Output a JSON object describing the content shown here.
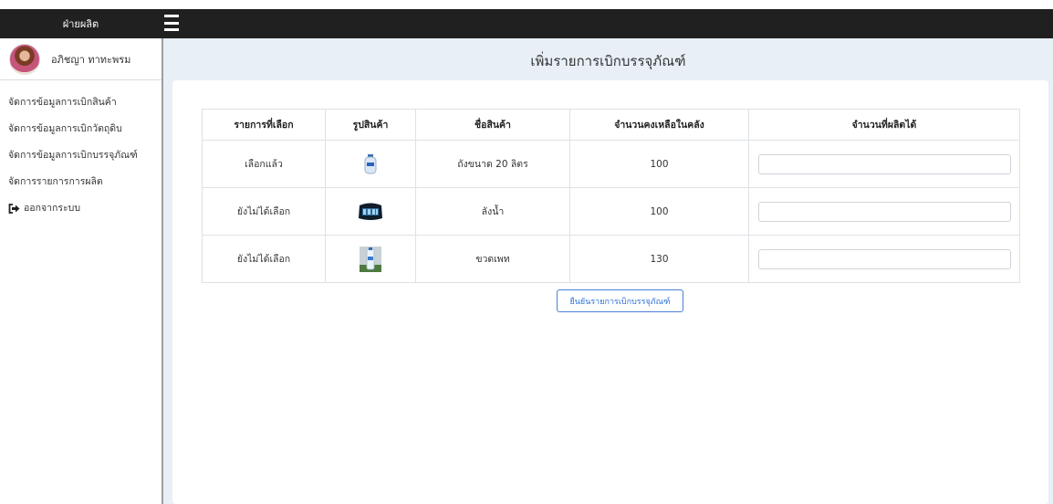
{
  "header": {
    "brand": "ฝ่ายผลิต",
    "menu_icon": "hamburger-icon"
  },
  "sidebar": {
    "user_name": "อภิชญา ทาทะพรม",
    "items": [
      {
        "label": "จัดการข้อมูลการเบิกสินค้า"
      },
      {
        "label": "จัดการข้อมูลการเบิกวัตถุดิบ"
      },
      {
        "label": "จัดการข้อมูลการเบิกบรรจุภัณฑ์"
      },
      {
        "label": "จัดการรายการการผลิต"
      },
      {
        "label": "ออกจากระบบ",
        "icon": "sign-out-icon"
      }
    ]
  },
  "main": {
    "title": "เพิ่มรายการเบิกบรรจุภัณฑ์",
    "table": {
      "headers": [
        "รายการที่เลือก",
        "รูปสินค้า",
        "ชื่อสินค้า",
        "จำนวนคงเหลือในคลัง",
        "จำนวนที่ผลิตได้"
      ],
      "rows": [
        {
          "status": "เลือกแล้ว",
          "image": "water-tank-image",
          "name": "ถังขนาด 20 ลิตร",
          "stock": "100",
          "produced": ""
        },
        {
          "status": "ยังไม่ได้เลือก",
          "image": "bottle-crate-image",
          "name": "ลังน้ำ",
          "stock": "100",
          "produced": ""
        },
        {
          "status": "ยังไม่ได้เลือก",
          "image": "pet-bottle-image",
          "name": "ขวดเพท",
          "stock": "130",
          "produced": ""
        }
      ]
    },
    "confirm_label": "ยืนยันรายการเบิกบรรจุภัณฑ์"
  },
  "colors": {
    "topbar": "#202020",
    "main_bg": "#e8eff7",
    "selected": "#28a745",
    "unselected": "#f0883e",
    "primary": "#2b6fd6"
  }
}
